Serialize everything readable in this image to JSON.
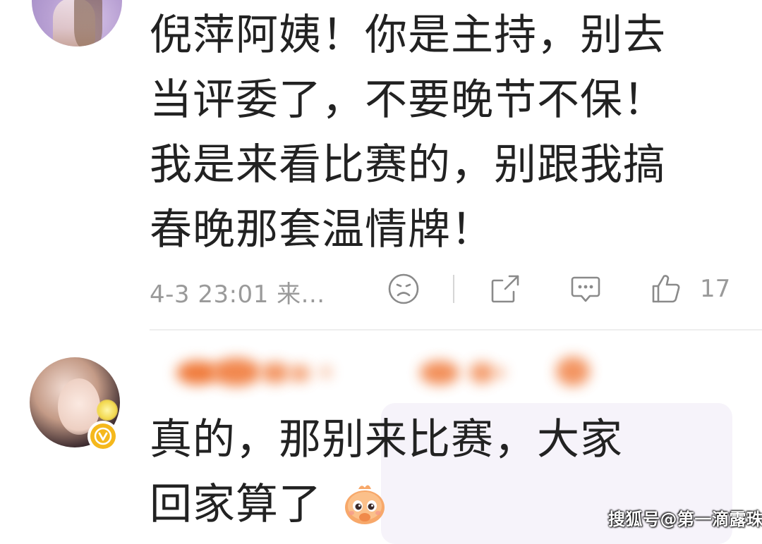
{
  "comments": [
    {
      "avatar": "avatar-illustrated-girl-purple",
      "lines": [
        "倪萍阿姨！你是主持，别去",
        "当评委了，不要晚节不保！",
        "我是来看比赛的，别跟我搞",
        "春晚那套温情牌！"
      ],
      "time": "4-3 23:01",
      "location": "来...",
      "like_count": "17"
    },
    {
      "avatar": "avatar-illustrated-girl-dark-hair",
      "verified_badge": "vip-v-icon",
      "lines": [
        "真的，那别来比赛，大家",
        "回家算了"
      ],
      "emoji": "shy-bird-emoji"
    }
  ],
  "icons": [
    "sad-face-icon",
    "share-icon",
    "reply-icon",
    "thumb-up-icon"
  ],
  "watermark": "搜狐号@第一滴露珠",
  "colors": {
    "text": "#222222",
    "meta": "#9a9a9a",
    "badge": "#f5b81c",
    "bubble": "#f6f3fa",
    "blur": "#f07a3a"
  }
}
